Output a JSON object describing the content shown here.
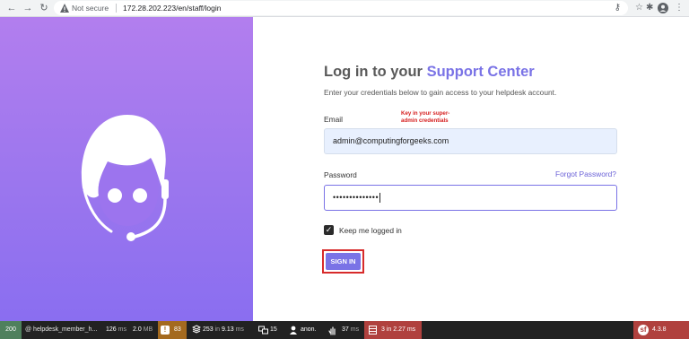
{
  "browser": {
    "back_icon": "←",
    "forward_icon": "→",
    "reload_icon": "↻",
    "security_label": "Not secure",
    "url": "172.28.202.223/en/staff/login",
    "key_icon": "⚷",
    "star_icon": "☆",
    "extensions_icon": "✱",
    "menu_icon": "⋮"
  },
  "login": {
    "title_prefix": "Log in to your ",
    "title_accent": "Support Center",
    "subtitle": "Enter your credentials below to gain access to your helpdesk account.",
    "email_label": "Email",
    "email_value": "admin@computingforgeeks.com",
    "annotation_line1": "Key in your super-",
    "annotation_line2": "admin credentials",
    "password_label": "Password",
    "password_value": "••••••••••••••",
    "forgot_link": "Forgot Password?",
    "keep_logged_in": "Keep me logged in",
    "keep_logged_in_checked": true,
    "check_glyph": "✓",
    "signin_label": "SIGN IN"
  },
  "toolbar": {
    "status": "200",
    "route": "@ helpdesk_member_h...",
    "time_value": "126",
    "time_unit": "ms",
    "memory_value": "2.0",
    "memory_unit": "MB",
    "warning_glyph": "!",
    "warnings": "83",
    "layers_count": "253",
    "layers_in": "in",
    "layers_time": "9.13",
    "layers_unit": "ms",
    "db_count": "15",
    "user": "anon.",
    "events_time": "37",
    "events_unit": "ms",
    "cache_count": "3",
    "cache_in": "in",
    "cache_time": "2.27",
    "cache_unit": "ms",
    "symfony_glyph": "sf",
    "symfony_version": "4.3.8"
  },
  "colors": {
    "accent": "#7a73e6",
    "gradient_top": "#b27eee",
    "gradient_bottom": "#8a6ef0",
    "annotation_red": "#d62020",
    "toolbar_green": "#4f805d",
    "toolbar_red": "#b0413e",
    "toolbar_orange": "#a46a1f"
  }
}
